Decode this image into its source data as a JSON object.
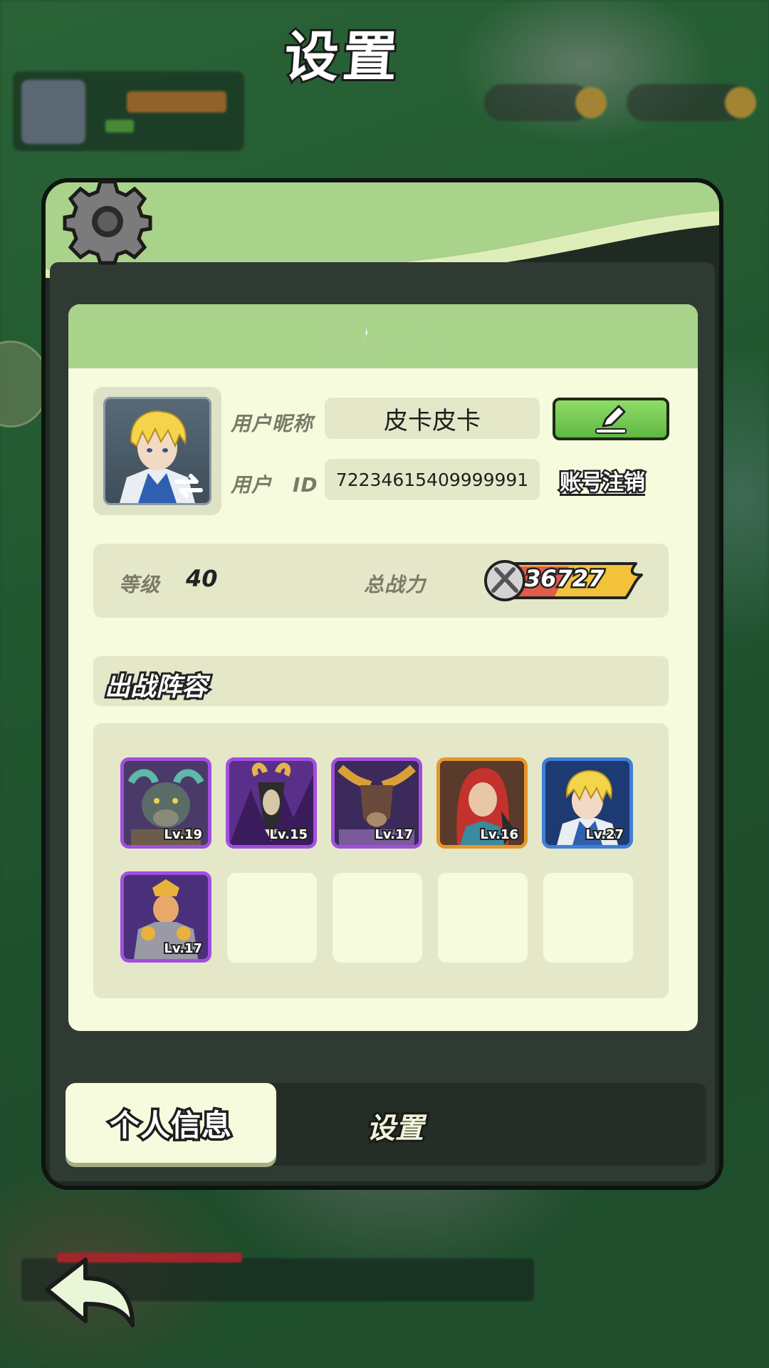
{
  "header": {
    "title": "设置"
  },
  "card": {
    "title": "个人信息"
  },
  "profile": {
    "nickname_label": "用户昵称",
    "nickname": "皮卡皮卡",
    "id_label": "用户　ID",
    "user_id": "72234615409999991",
    "logout_label": "账号注销"
  },
  "stats": {
    "level_label": "等级",
    "level": "40",
    "power_label": "总战力",
    "power": "36727"
  },
  "team": {
    "title": "出战阵容",
    "heroes": [
      {
        "name": "horned-beast-hero",
        "level": "Lv.19",
        "rarity": "purple"
      },
      {
        "name": "goat-demon-hero",
        "level": "Lv.15",
        "rarity": "purple"
      },
      {
        "name": "minotaur-hero",
        "level": "Lv.17",
        "rarity": "purple"
      },
      {
        "name": "red-haired-hero",
        "level": "Lv.16",
        "rarity": "orange"
      },
      {
        "name": "blonde-knight-hero",
        "level": "Lv.27",
        "rarity": "blue"
      },
      {
        "name": "armored-warrior-hero",
        "level": "Lv.17",
        "rarity": "purple"
      }
    ],
    "empty_slots": 4
  },
  "tabs": {
    "active": "个人信息",
    "settings": "设置"
  },
  "colors": {
    "panel_green": "#a9d28b",
    "card_bg": "#f5fbdc",
    "field_bg": "#e4e8c8",
    "rarity_purple": "#a24ee0",
    "rarity_orange": "#e5962c",
    "rarity_blue": "#3f7fd8",
    "edit_green": "#6cc64c"
  },
  "icons": [
    "gear-icon",
    "swap-icon",
    "pencil-icon",
    "sword-badge-icon",
    "back-arrow-icon"
  ]
}
